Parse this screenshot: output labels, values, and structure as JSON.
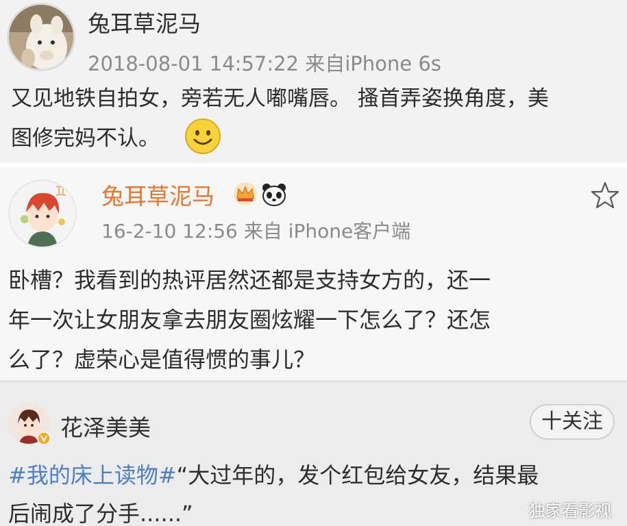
{
  "post1": {
    "username": "兔耳草泥马",
    "meta": "2018-08-01 14:57:22  来自iPhone 6s",
    "lines": [
      "又见地铁自拍女，旁若无人嘟嘴唇。 搔首弄姿换角度，美",
      "图修完妈不认。"
    ],
    "emoji": "smile-emoji"
  },
  "post2": {
    "username": "兔耳草泥马",
    "badges": [
      "crown-icon",
      "panda-icon"
    ],
    "meta": "16-2-10 12:56  来自 iPhone客户端",
    "lines": [
      "卧槽？我看到的热评居然还都是支持女方的，还一",
      "年一次让女朋友拿去朋友圈炫耀一下怎么了？还怎",
      "么了？虚荣心是值得惯的事儿？"
    ],
    "favorite_icon": "star-outline-icon"
  },
  "post3": {
    "username": "花泽美美",
    "follow_label": "十关注",
    "hashtag": "#我的床上读物#",
    "line1_rest": "“大过年的，发个红包给女友，结果最",
    "line2": "后闹成了分手......”"
  },
  "watermark": "独家看影视",
  "colors": {
    "accent_orange": "#e8752b",
    "hashtag_blue": "#4d7fc4",
    "meta_gray": "#8a8a8a"
  }
}
